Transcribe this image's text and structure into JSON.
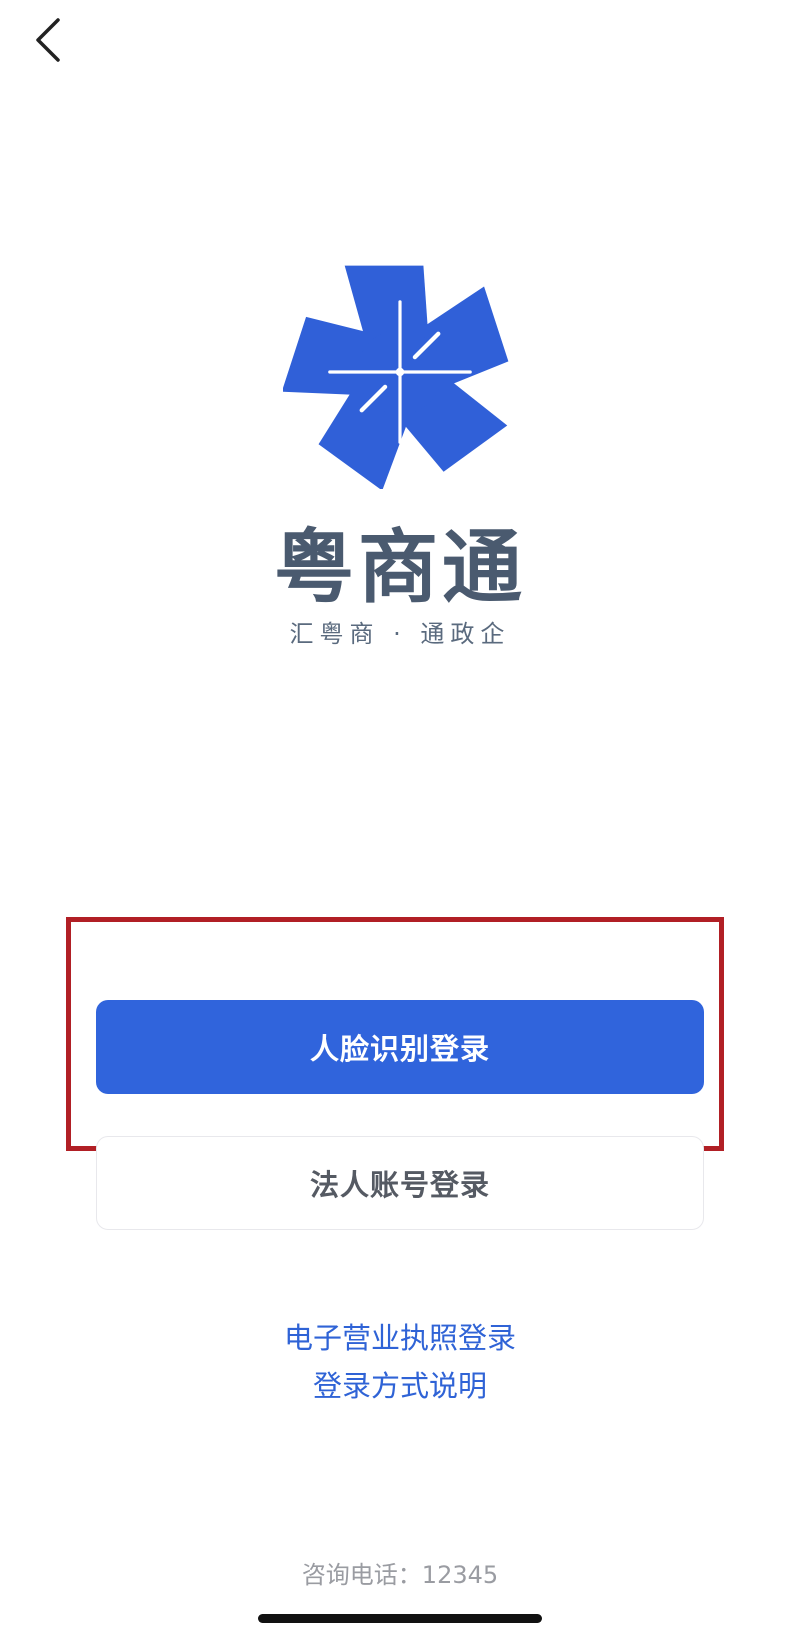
{
  "header": {
    "back_icon": "chevron-left-icon"
  },
  "brand": {
    "logo_icon": "pinwheel-star-logo",
    "name": "粤商通",
    "slogan": "汇粤商 · 通政企"
  },
  "actions": {
    "face_login_label": "人脸识别登录",
    "account_login_label": "法人账号登录",
    "license_login_label": "电子营业执照登录",
    "login_help_label": "登录方式说明"
  },
  "footer": {
    "consult_text": "咨询电话：12345"
  },
  "colors": {
    "primary": "#3064dc",
    "link": "#2f63d6",
    "highlight": "#b11f25",
    "brand_text": "#4a5a6f"
  }
}
